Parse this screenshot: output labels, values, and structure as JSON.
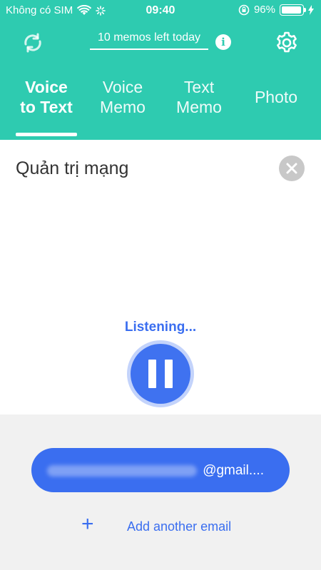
{
  "status_bar": {
    "carrier": "Không có SIM",
    "time": "09:40",
    "battery": "96%"
  },
  "toolbar": {
    "memos_left": "10 memos left today",
    "info_label": "i"
  },
  "tabs": [
    {
      "line1": "Voice",
      "line2": "to Text",
      "active": true
    },
    {
      "line1": "Voice",
      "line2": "Memo",
      "active": false
    },
    {
      "line1": "Text",
      "line2": "Memo",
      "active": false
    },
    {
      "line1": "Photo",
      "line2": "",
      "active": false
    }
  ],
  "note": {
    "title": "Quản trị mạng"
  },
  "recorder": {
    "status": "Listening..."
  },
  "email": {
    "address_suffix": "@gmail....",
    "add_label": "Add another email",
    "add_symbol": "+"
  },
  "colors": {
    "header": "#2ecbb0",
    "accent": "#3a6ef0",
    "bottom_bg": "#f1f1f1"
  }
}
